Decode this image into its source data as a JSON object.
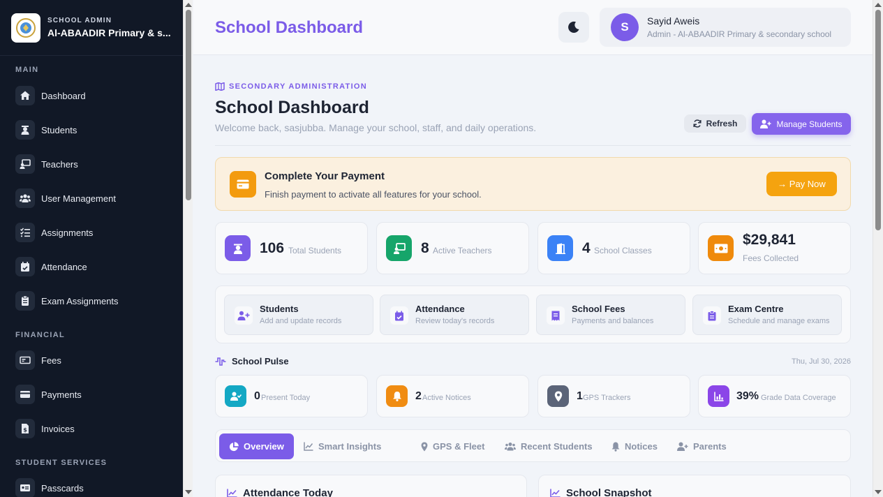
{
  "sidebar": {
    "kicker": "SCHOOL ADMIN",
    "school_name": "Al-ABAADIR Primary & s...",
    "sections": {
      "main": "MAIN",
      "financial": "FINANCIAL",
      "student_services": "STUDENT SERVICES"
    },
    "items": [
      {
        "label": "Dashboard",
        "icon": "home-icon"
      },
      {
        "label": "Students",
        "icon": "student-icon"
      },
      {
        "label": "Teachers",
        "icon": "teacher-icon"
      },
      {
        "label": "User Management",
        "icon": "users-icon"
      },
      {
        "label": "Assignments",
        "icon": "list-check-icon"
      },
      {
        "label": "Attendance",
        "icon": "calendar-check-icon"
      },
      {
        "label": "Exam Assignments",
        "icon": "clipboard-icon"
      },
      {
        "label": "Fees",
        "icon": "money-icon"
      },
      {
        "label": "Payments",
        "icon": "credit-card-icon"
      },
      {
        "label": "Invoices",
        "icon": "invoice-icon"
      },
      {
        "label": "Passcards",
        "icon": "id-card-icon"
      }
    ]
  },
  "header": {
    "title": "School Dashboard",
    "user": {
      "initial": "S",
      "name": "Sayid Aweis",
      "role": "Admin - Al-ABAADIR Primary & secondary school"
    }
  },
  "page": {
    "kicker": "SECONDARY ADMINISTRATION",
    "title": "School Dashboard",
    "subtitle": "Welcome back, sasjubba. Manage your school, staff, and daily operations.",
    "refresh_label": "Refresh",
    "manage_label": "Manage Students"
  },
  "payment": {
    "title": "Complete Your Payment",
    "subtitle": "Finish payment to activate all features for your school.",
    "button": "→ Pay Now"
  },
  "stats": [
    {
      "value": "106",
      "label": "Total Students",
      "color": "#7b5ce8",
      "icon": "graduate-icon"
    },
    {
      "value": "8",
      "label": "Active Teachers",
      "color": "#16a56a",
      "icon": "teacher-board-icon"
    },
    {
      "value": "4",
      "label": "School Classes",
      "color": "#3b82f6",
      "icon": "door-icon"
    },
    {
      "value": "$29,841",
      "label": "Fees Collected",
      "color": "#ef8a0c",
      "icon": "cash-icon"
    }
  ],
  "quick_actions": [
    {
      "title": "Students",
      "subtitle": "Add and update records",
      "icon": "user-plus-icon"
    },
    {
      "title": "Attendance",
      "subtitle": "Review today's records",
      "icon": "calendar-check-icon"
    },
    {
      "title": "School Fees",
      "subtitle": "Payments and balances",
      "icon": "receipt-icon"
    },
    {
      "title": "Exam Centre",
      "subtitle": "Schedule and manage exams",
      "icon": "clipboard-icon"
    }
  ],
  "pulse": {
    "title": "School Pulse",
    "date": "Thu, Jul 30, 2026",
    "items": [
      {
        "value": "0",
        "label": "Present Today",
        "color": "#14a8c4",
        "icon": "user-check-icon"
      },
      {
        "value": "2",
        "label": "Active Notices",
        "color": "#f08c12",
        "icon": "bell-icon"
      },
      {
        "value": "1",
        "label": "GPS Trackers",
        "color": "#5b6478",
        "icon": "map-pin-icon"
      },
      {
        "value": "39%",
        "label": "Grade Data Coverage",
        "color": "#8b46e8",
        "icon": "chart-icon"
      }
    ]
  },
  "tabs": [
    {
      "label": "Overview",
      "icon": "pie-icon"
    },
    {
      "label": "Smart Insights",
      "icon": "line-chart-icon"
    },
    {
      "label": "GPS & Fleet",
      "icon": "map-pin-icon"
    },
    {
      "label": "Recent Students",
      "icon": "users-icon"
    },
    {
      "label": "Notices",
      "icon": "bell-icon"
    },
    {
      "label": "Parents",
      "icon": "user-plus-icon"
    }
  ],
  "panels": {
    "attendance_today": "Attendance Today",
    "school_snapshot": "School Snapshot"
  }
}
